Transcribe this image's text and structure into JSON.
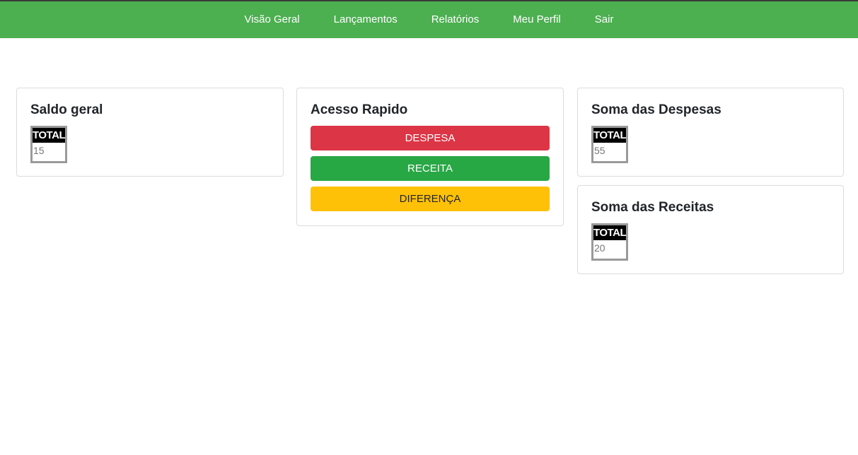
{
  "nav": {
    "items": [
      {
        "label": "Visão Geral"
      },
      {
        "label": "Lançamentos"
      },
      {
        "label": "Relatórios"
      },
      {
        "label": "Meu Perfil"
      },
      {
        "label": "Sair"
      }
    ]
  },
  "saldo": {
    "title": "Saldo geral",
    "total_label": "TOTAL",
    "value": "15"
  },
  "acesso": {
    "title": "Acesso Rapido",
    "despesa_label": "DESPESA",
    "receita_label": "RECEITA",
    "diferenca_label": "DIFERENÇA"
  },
  "despesas": {
    "title": "Soma das Despesas",
    "total_label": "TOTAL",
    "value": "55"
  },
  "receitas": {
    "title": "Soma das Receitas",
    "total_label": "TOTAL",
    "value": "20"
  },
  "colors": {
    "navbar": "#4caf50",
    "despesa": "#dc3545",
    "receita": "#28a745",
    "diferenca": "#ffc107"
  }
}
